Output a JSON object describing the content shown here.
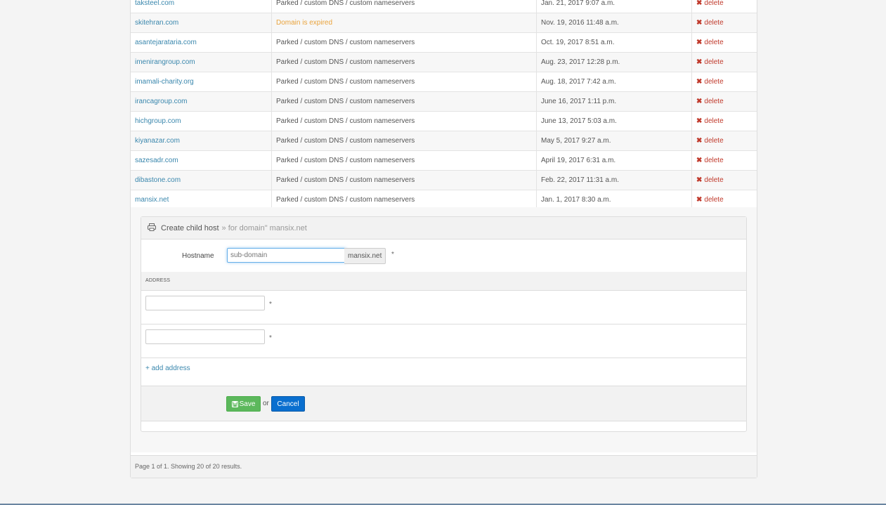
{
  "rows": [
    {
      "domain": "taksteel.com",
      "status": "Parked / custom DNS / custom nameservers",
      "date": "Jan. 21, 2017 9:07 a.m.",
      "delete": "delete"
    },
    {
      "domain": "skitehran.com",
      "status": "Domain is expired",
      "status_color": "#e9a33c",
      "date": "Nov. 19, 2016 11:48 a.m.",
      "delete": "delete"
    },
    {
      "domain": "asantejarataria.com",
      "status": "Parked / custom DNS / custom nameservers",
      "date": "Oct. 19, 2017 8:51 a.m.",
      "delete": "delete"
    },
    {
      "domain": "imenirangroup.com",
      "status": "Parked / custom DNS / custom nameservers",
      "date": "Aug. 23, 2017 12:28 p.m.",
      "delete": "delete"
    },
    {
      "domain": "imamali-charity.org",
      "status": "Parked / custom DNS / custom nameservers",
      "date": "Aug. 18, 2017 7:42 a.m.",
      "delete": "delete"
    },
    {
      "domain": "irancagroup.com",
      "status": "Parked / custom DNS / custom nameservers",
      "date": "June 16, 2017 1:11 p.m.",
      "delete": "delete"
    },
    {
      "domain": "hichgroup.com",
      "status": "Parked / custom DNS / custom nameservers",
      "date": "June 13, 2017 5:03 a.m.",
      "delete": "delete"
    },
    {
      "domain": "kiyanazar.com",
      "status": "Parked / custom DNS / custom nameservers",
      "date": "May 5, 2017 9:27 a.m.",
      "delete": "delete"
    },
    {
      "domain": "sazesadr.com",
      "status": "Parked / custom DNS / custom nameservers",
      "date": "April 19, 2017 6:31 a.m.",
      "delete": "delete"
    },
    {
      "domain": "dibastone.com",
      "status": "Parked / custom DNS / custom nameservers",
      "date": "Feb. 22, 2017 11:31 a.m.",
      "delete": "delete"
    },
    {
      "domain": "mansix.net",
      "status": "Parked / custom DNS / custom nameservers",
      "date": "Jan. 1, 2017 8:30 a.m.",
      "delete": "delete"
    }
  ],
  "icons": {
    "delete": "close-icon",
    "header": "printer-icon",
    "save": "floppy-disk-icon"
  },
  "colors": {
    "link": "#3a87ad",
    "expired": "#e9a33c",
    "delete": "#c0392b",
    "save": "#5cb85c",
    "cancel": "#0a6fcf"
  },
  "child_host": {
    "title": "Create child host",
    "subtitle": "» for domain\" mansix.net",
    "hostname_label": "Hostname",
    "hostname_placeholder": "sub-domain",
    "hostname_suffix": "mansix.net",
    "required_mark": "*",
    "address_header": "ADDRESS",
    "add_address": "+ add address",
    "save_label": "Save",
    "or_label": "or",
    "cancel_label": "Cancel"
  },
  "pagination": {
    "text": "Page 1 of 1. Showing 20 of 20 results."
  }
}
